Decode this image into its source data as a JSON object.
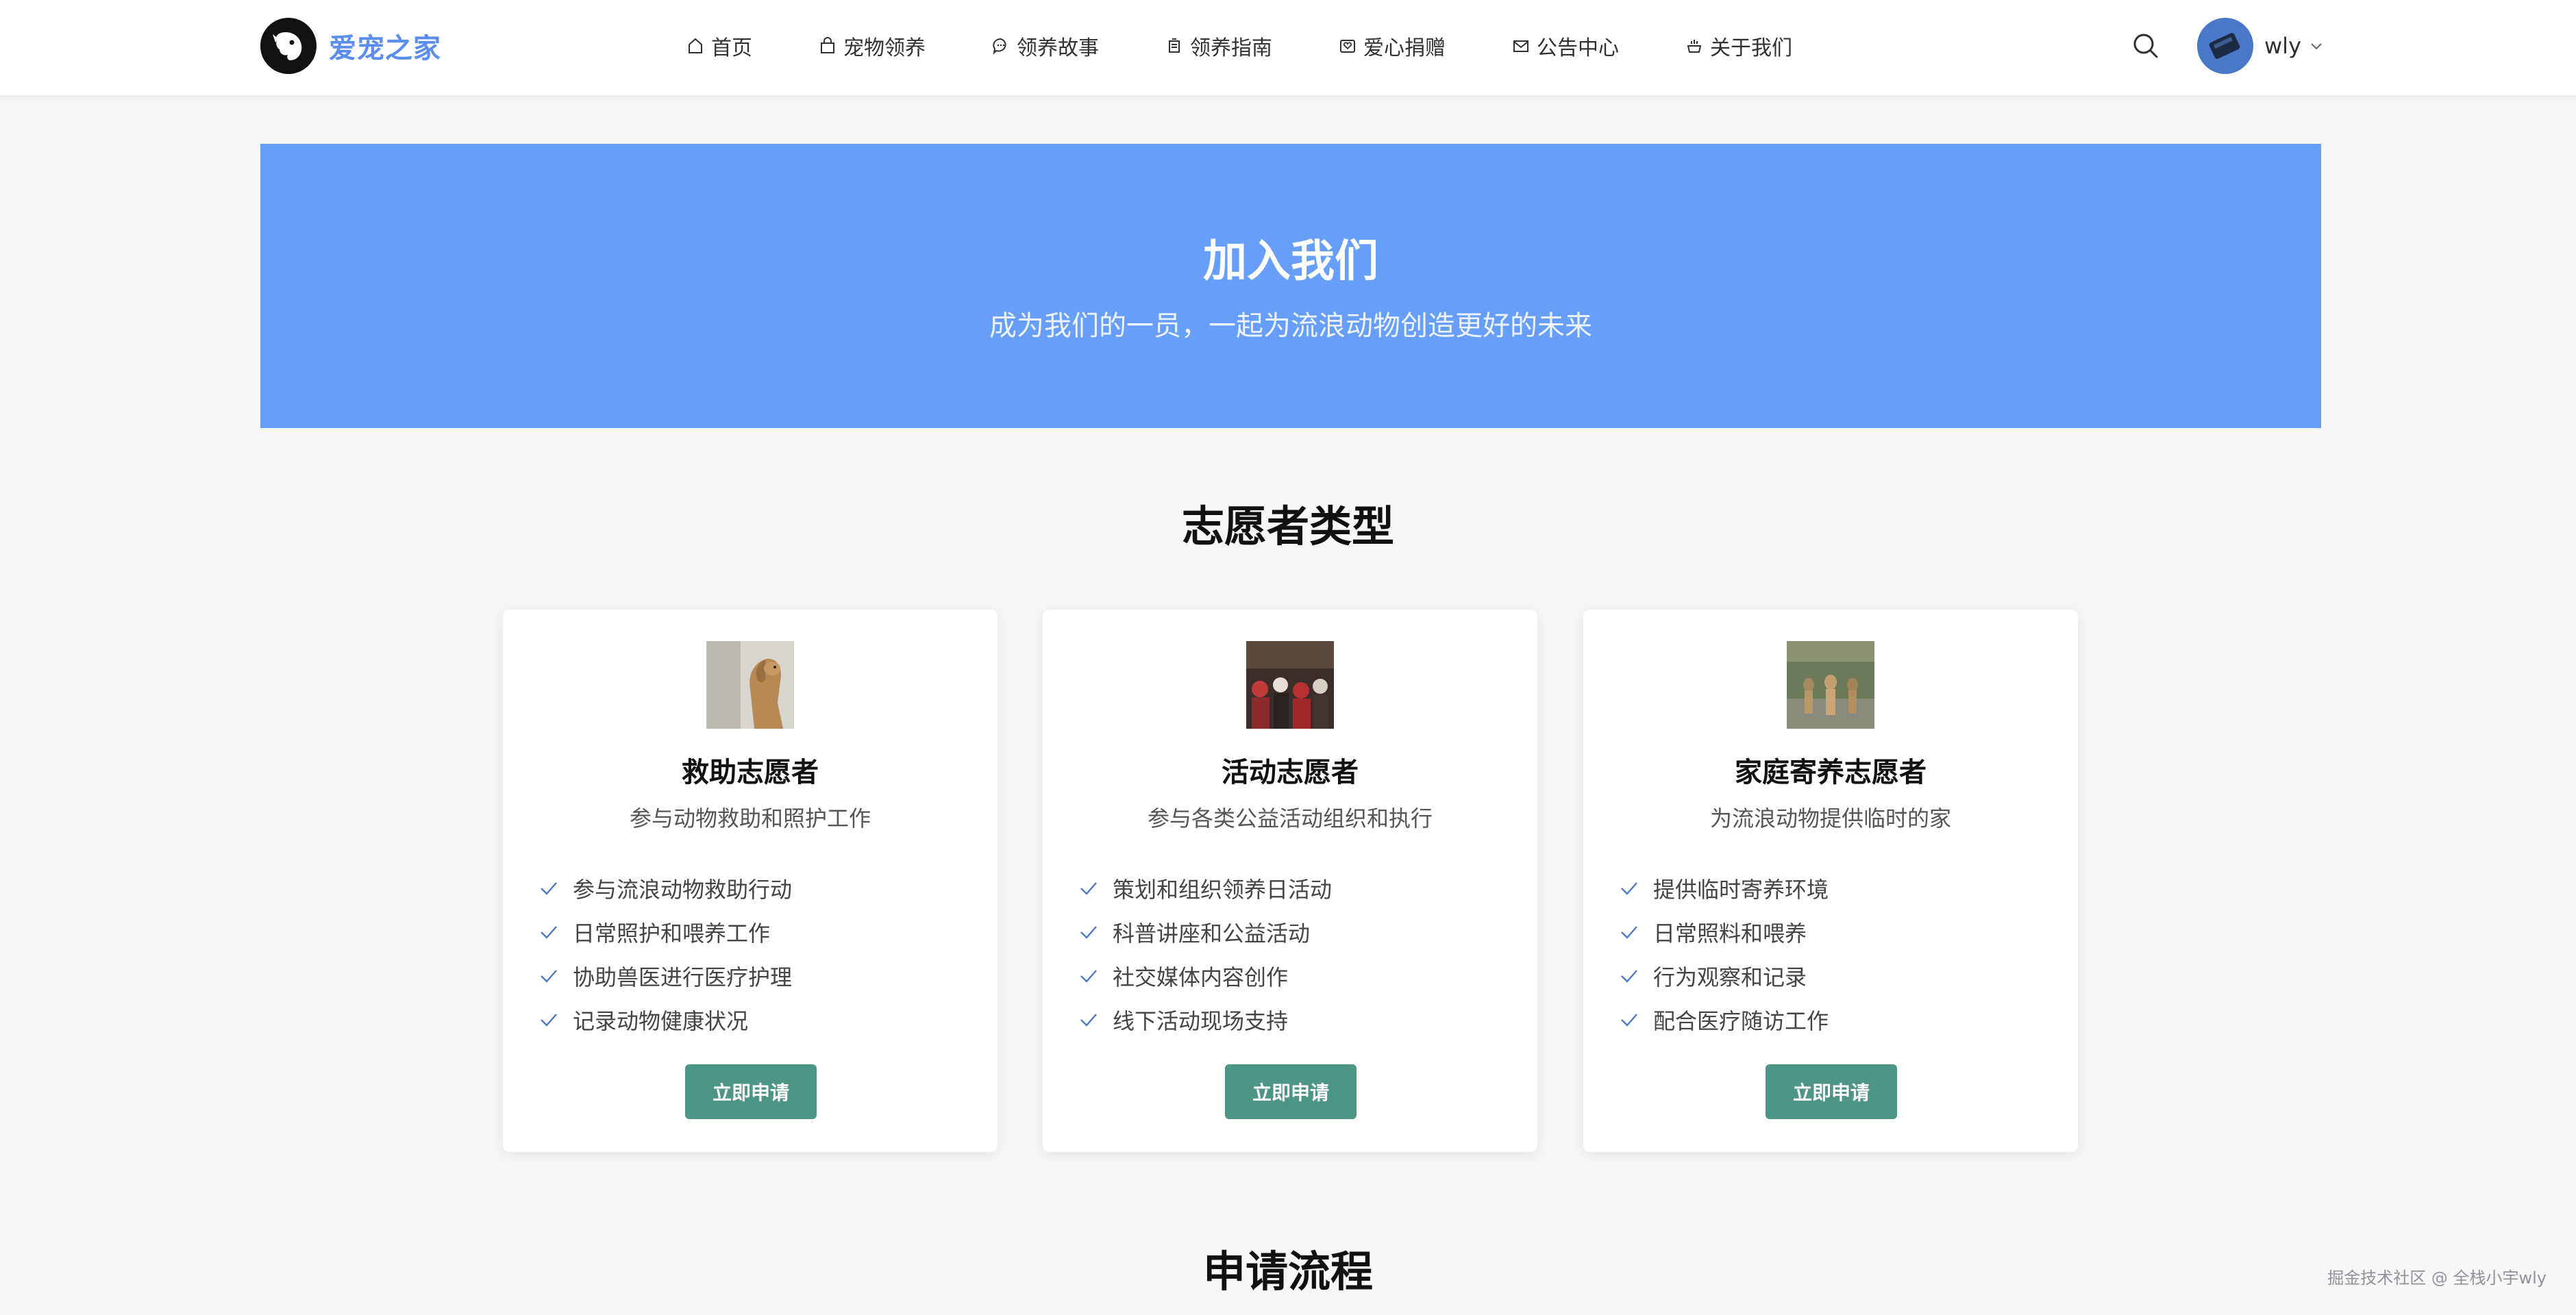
{
  "brand": {
    "name": "爱宠之家",
    "color": "#5b8def"
  },
  "nav": [
    {
      "label": "首页",
      "icon": "home-icon"
    },
    {
      "label": "宠物领养",
      "icon": "bag-icon"
    },
    {
      "label": "领养故事",
      "icon": "chat-icon"
    },
    {
      "label": "领养指南",
      "icon": "guide-icon"
    },
    {
      "label": "爱心捐赠",
      "icon": "donate-icon"
    },
    {
      "label": "公告中心",
      "icon": "mail-icon"
    },
    {
      "label": "关于我们",
      "icon": "about-icon"
    }
  ],
  "user": {
    "name": "wly"
  },
  "hero": {
    "title": "加入我们",
    "subtitle": "成为我们的一员，一起为流浪动物创造更好的未来",
    "background": "#669ef9"
  },
  "sections": {
    "types_title": "志愿者类型",
    "process_title": "申请流程"
  },
  "cards": [
    {
      "title": "救助志愿者",
      "desc": "参与动物救助和照护工作",
      "items": [
        "参与流浪动物救助行动",
        "日常照护和喂养工作",
        "协助兽医进行医疗护理",
        "记录动物健康状况"
      ],
      "button": "立即申请"
    },
    {
      "title": "活动志愿者",
      "desc": "参与各类公益活动组织和执行",
      "items": [
        "策划和组织领养日活动",
        "科普讲座和公益活动",
        "社交媒体内容创作",
        "线下活动现场支持"
      ],
      "button": "立即申请"
    },
    {
      "title": "家庭寄养志愿者",
      "desc": "为流浪动物提供临时的家",
      "items": [
        "提供临时寄养环境",
        "日常照料和喂养",
        "行为观察和记录",
        "配合医疗随访工作"
      ],
      "button": "立即申请"
    }
  ],
  "accent": "#4d9584",
  "watermark": "掘金技术社区 @ 全栈小宇wly"
}
